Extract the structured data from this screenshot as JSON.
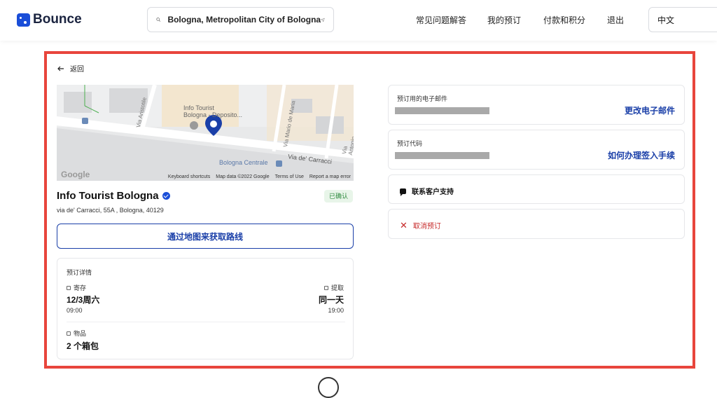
{
  "brand": {
    "name": "Bounce",
    "accent": "#1a4ed8"
  },
  "search": {
    "location": "Bologna, Metropolitan City of Bologna",
    "icon": "search-icon",
    "locate_icon": "location-arrow-icon"
  },
  "nav": {
    "faq": "常见问题解答",
    "bookings": "我的预订",
    "payments": "付款和积分",
    "logout": "退出",
    "language": "中文"
  },
  "back": {
    "label": "返回"
  },
  "map": {
    "place_label_line1": "Info Tourist",
    "place_label_line2": "Bologna - Deposito...",
    "street_1": "Via Aristotile",
    "street_2": "Via Mario de Maria",
    "street_3": "Via Antonio di Vincenzo",
    "street_4": "Via de' Carracci",
    "station": "Bologna Centrale",
    "google": "Google",
    "credits": [
      "Keyboard shortcuts",
      "Map data ©2022 Google",
      "Terms of Use",
      "Report a map error"
    ]
  },
  "place": {
    "name": "Info Tourist Bologna",
    "status": "已确认",
    "address": "via de' Carracci, 55A , Bologna, 40129",
    "route_button": "通过地图来获取路线"
  },
  "details": {
    "title": "预订详情",
    "dropoff_label": "寄存",
    "dropoff_date": "12/3周六",
    "dropoff_time": "09:00",
    "pickup_label": "提取",
    "pickup_date": "同一天",
    "pickup_time": "19:00",
    "items_label": "物品",
    "items_value": "2 个箱包"
  },
  "right": {
    "email_label": "预订用的电子邮件",
    "email_link": "更改电子邮件",
    "code_label": "预订代码",
    "code_link": "如何办理签入手续",
    "support": "联系客户支持",
    "cancel": "取消预订"
  },
  "colors": {
    "highlight_frame": "#e8453c",
    "link": "#1a3fa8",
    "confirmed_bg": "#e8f5e9",
    "confirmed_text": "#2e8b3e",
    "cancel": "#c62828"
  }
}
